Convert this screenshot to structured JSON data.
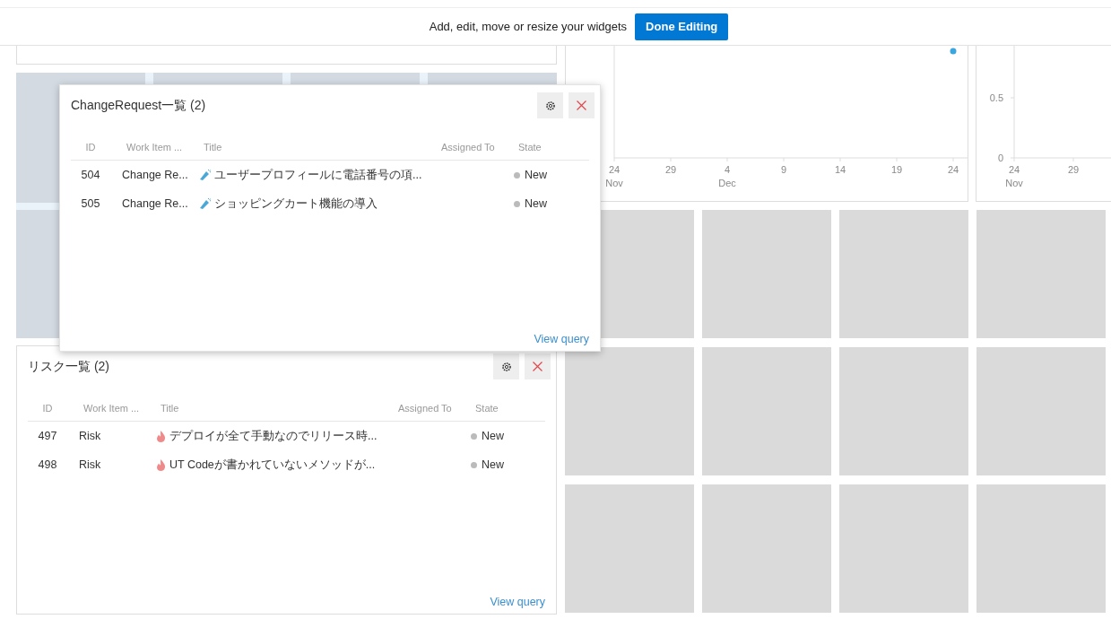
{
  "header": {
    "message": "Add, edit, move or resize your widgets",
    "done_button": "Done Editing"
  },
  "widgets": [
    {
      "title": "ChangeRequest一覧 (2)",
      "floating": true,
      "columns": [
        "ID",
        "Work Item ...",
        "Title",
        "Assigned To",
        "State"
      ],
      "rows": [
        {
          "id": "504",
          "type": "Change Re...",
          "kind": "change-request",
          "title": "ユーザープロフィールに電話番号の項...",
          "state": "New"
        },
        {
          "id": "505",
          "type": "Change Re...",
          "kind": "change-request",
          "title": "ショッピングカート機能の導入",
          "state": "New"
        }
      ],
      "link": "View query"
    },
    {
      "title": "リスク一覧 (2)",
      "floating": false,
      "columns": [
        "ID",
        "Work Item ...",
        "Title",
        "Assigned To",
        "State"
      ],
      "rows": [
        {
          "id": "497",
          "type": "Risk",
          "kind": "risk",
          "title": "デプロイが全て手動なのでリリース時...",
          "state": "New"
        },
        {
          "id": "498",
          "type": "Risk",
          "kind": "risk",
          "title": "UT Codeが書かれていないメソッドが...",
          "state": "New"
        }
      ],
      "link": "View query"
    }
  ],
  "charts": [
    {
      "marker": true,
      "xticks": [
        {
          "day": "24",
          "month": "Nov"
        },
        {
          "day": "29"
        },
        {
          "day": "4",
          "month": "Dec"
        },
        {
          "day": "9"
        },
        {
          "day": "14"
        },
        {
          "day": "19"
        },
        {
          "day": "24"
        }
      ]
    },
    {
      "yticks": [
        "0.5",
        "0"
      ],
      "xticks": [
        {
          "day": "24",
          "month": "Nov"
        },
        {
          "day": "29"
        }
      ]
    }
  ]
}
